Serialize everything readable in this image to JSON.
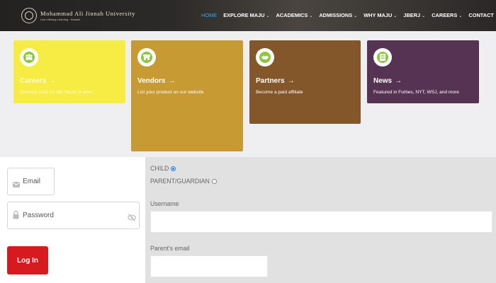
{
  "header": {
    "logo_name": "Mohammad Ali Jinnah University",
    "logo_tagline": "Live Lifelong Learning · Karachi",
    "nav": [
      {
        "label": "HOME",
        "active": true,
        "dropdown": false
      },
      {
        "label": "EXPLORE MAJU",
        "active": false,
        "dropdown": true
      },
      {
        "label": "ACADEMICS",
        "active": false,
        "dropdown": true
      },
      {
        "label": "ADMISSIONS",
        "active": false,
        "dropdown": true
      },
      {
        "label": "WHY MAJU",
        "active": false,
        "dropdown": true
      },
      {
        "label": "JBERJ",
        "active": false,
        "dropdown": true
      },
      {
        "label": "CAREERS",
        "active": false,
        "dropdown": true
      },
      {
        "label": "CONTACT",
        "active": false,
        "dropdown": false
      }
    ],
    "search_icon": "search-icon"
  },
  "cards": [
    {
      "title": "Careers",
      "description": "Develop skills for the future of work",
      "color": "#f6ec43",
      "icon": "people-icon"
    },
    {
      "title": "Vendors",
      "description": "List your product on our website",
      "color": "#c79a34",
      "icon": "storefront-icon"
    },
    {
      "title": "Partners",
      "description": "Become a paid affiliate",
      "color": "#84572a",
      "icon": "handshake-icon"
    },
    {
      "title": "News",
      "description": "Featured in Forbes, NYT, WSJ, and more",
      "color": "#573353",
      "icon": "newspaper-icon"
    }
  ],
  "login": {
    "email_placeholder": "Email",
    "password_placeholder": "Password",
    "button_label": "Log In",
    "button_color": "#d71920"
  },
  "signup_form": {
    "role_options": [
      {
        "label": "CHILD",
        "selected": true
      },
      {
        "label": "PARENT/GUARDIAN",
        "selected": false
      }
    ],
    "username_label": "Username",
    "username_value": "",
    "parent_email_label": "Parent's email",
    "parent_email_value": ""
  }
}
